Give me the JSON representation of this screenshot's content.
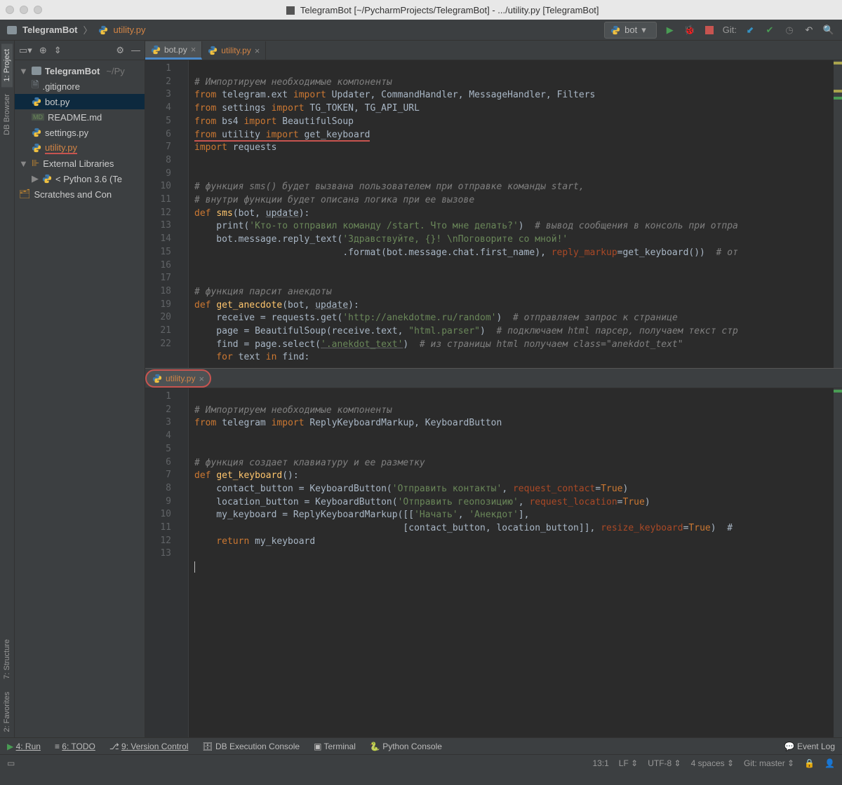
{
  "titlebar": {
    "text": "TelegramBot [~/PycharmProjects/TelegramBot] - .../utility.py [TelegramBot]"
  },
  "breadcrumb": {
    "project": "TelegramBot",
    "file": "utility.py"
  },
  "run_config": {
    "name": "bot",
    "git_label": "Git:"
  },
  "sidebar_tabs": {
    "project": "1: Project",
    "db": "DB Browser",
    "structure": "7: Structure",
    "favorites": "2: Favorites"
  },
  "tree": {
    "root": "TelegramBot",
    "root_path": "~/Py",
    "items": [
      {
        "name": ".gitignore",
        "type": "file"
      },
      {
        "name": "bot.py",
        "type": "py",
        "selected": true
      },
      {
        "name": "README.md",
        "type": "md"
      },
      {
        "name": "settings.py",
        "type": "py"
      },
      {
        "name": "utility.py",
        "type": "py",
        "underline": true
      }
    ],
    "ext_lib": "External Libraries",
    "python_env": "< Python 3.6 (Te",
    "scratches": "Scratches and Con"
  },
  "tabs_top": [
    {
      "name": "bot.py",
      "active": true
    },
    {
      "name": "utility.py"
    }
  ],
  "tabs_bot": [
    {
      "name": "utility.py",
      "active": true,
      "circled": true
    }
  ],
  "editor_top": {
    "lines": [
      "1",
      "2",
      "3",
      "4",
      "5",
      "6",
      "7",
      "8",
      "9",
      "10",
      "11",
      "12",
      "13",
      "14",
      "15",
      "16",
      "17",
      "18",
      "19",
      "20",
      "21",
      "22"
    ]
  },
  "editor_bot": {
    "lines": [
      "1",
      "2",
      "3",
      "4",
      "5",
      "6",
      "7",
      "8",
      "9",
      "10",
      "11",
      "12",
      "13"
    ]
  },
  "code_top": {
    "l1": "# Импортируем необходимые компоненты",
    "l2a": "from",
    "l2b": " telegram.ext ",
    "l2c": "import",
    "l2d": " Updater, CommandHandler, MessageHandler, Filters",
    "l3a": "from",
    "l3b": " settings ",
    "l3c": "import",
    "l3d": " TG_TOKEN, TG_API_URL",
    "l4a": "from",
    "l4b": " bs4 ",
    "l4c": "import",
    "l4d": " BeautifulSoup",
    "l5a": "from",
    "l5b": " utility ",
    "l5c": "import",
    "l5d": " get_keyboard",
    "l6a": "import",
    "l6b": " requests",
    "l9": "# функция sms() будет вызвана пользователем при отправке команды start,",
    "l10": "# внутри функции будет описана логика при ее вызове",
    "l11a": "def ",
    "l11b": "sms",
    "l11c": "(bot, ",
    "l11d": "update",
    "l11e": "):",
    "l12a": "    print(",
    "l12b": "'Кто-то отправил команду /start. Что мне делать?'",
    "l12c": ")  ",
    "l12d": "# вывод сообщения в консоль при отпра",
    "l13a": "    bot.message.reply_text(",
    "l13b": "'Здравствуйте, {}! \\nПоговорите со мной!'",
    "l14a": "                           .format(bot.message.chat.first_name), ",
    "l14b": "reply_markup",
    "l14c": "=get_keyboard())  ",
    "l14d": "# от",
    "l17": "# функция парсит анекдоты",
    "l18a": "def ",
    "l18b": "get_anecdote",
    "l18c": "(bot, ",
    "l18d": "update",
    "l18e": "):",
    "l19a": "    receive = requests.get(",
    "l19b": "'http://anekdotme.ru/random'",
    "l19c": ")  ",
    "l19d": "# отправляем запрос к странице",
    "l20a": "    page = BeautifulSoup(receive.text, ",
    "l20b": "\"html.parser\"",
    "l20c": ")  ",
    "l20d": "# подключаем html парсер, получаем текст стр",
    "l21a": "    find = page.select(",
    "l21b": "'.anekdot_text'",
    "l21c": ")  ",
    "l21d": "# из страницы html получаем class=\"anekdot_text\"",
    "l22a": "    for ",
    "l22b": "text ",
    "l22c": "in ",
    "l22d": "find:"
  },
  "code_bot": {
    "l1": "# Импортируем необходимые компоненты",
    "l2a": "from",
    "l2b": " telegram ",
    "l2c": "import",
    "l2d": " ReplyKeyboardMarkup, KeyboardButton",
    "l5": "# функция создает клавиатуру и ее разметку",
    "l6a": "def ",
    "l6b": "get_keyboard",
    "l6c": "():",
    "l7a": "    contact_button = KeyboardButton(",
    "l7b": "'Отправить контакты'",
    "l7c": ", ",
    "l7d": "request_contact",
    "l7e": "=",
    "l7f": "True",
    "l7g": ")",
    "l8a": "    location_button = KeyboardButton(",
    "l8b": "'Отправить геопозицию'",
    "l8c": ", ",
    "l8d": "request_location",
    "l8e": "=",
    "l8f": "True",
    "l8g": ")",
    "l9a": "    my_keyboard = ReplyKeyboardMarkup([[",
    "l9b": "'Начать'",
    "l9c": ", ",
    "l9d": "'Анекдот'",
    "l9e": "],",
    "l10a": "                                      [contact_button, location_button]], ",
    "l10b": "resize_keyboard",
    "l10c": "=",
    "l10d": "True",
    "l10e": ")  #",
    "l11a": "    return ",
    "l11b": "my_keyboard"
  },
  "bottom_tools": {
    "run": "4: Run",
    "todo": "6: TODO",
    "vcs": "9: Version Control",
    "db": "DB Execution Console",
    "terminal": "Terminal",
    "pyconsole": "Python Console",
    "eventlog": "Event Log"
  },
  "status": {
    "pos": "13:1",
    "le": "LF",
    "enc": "UTF-8",
    "indent": "4 spaces",
    "git": "Git: master"
  }
}
